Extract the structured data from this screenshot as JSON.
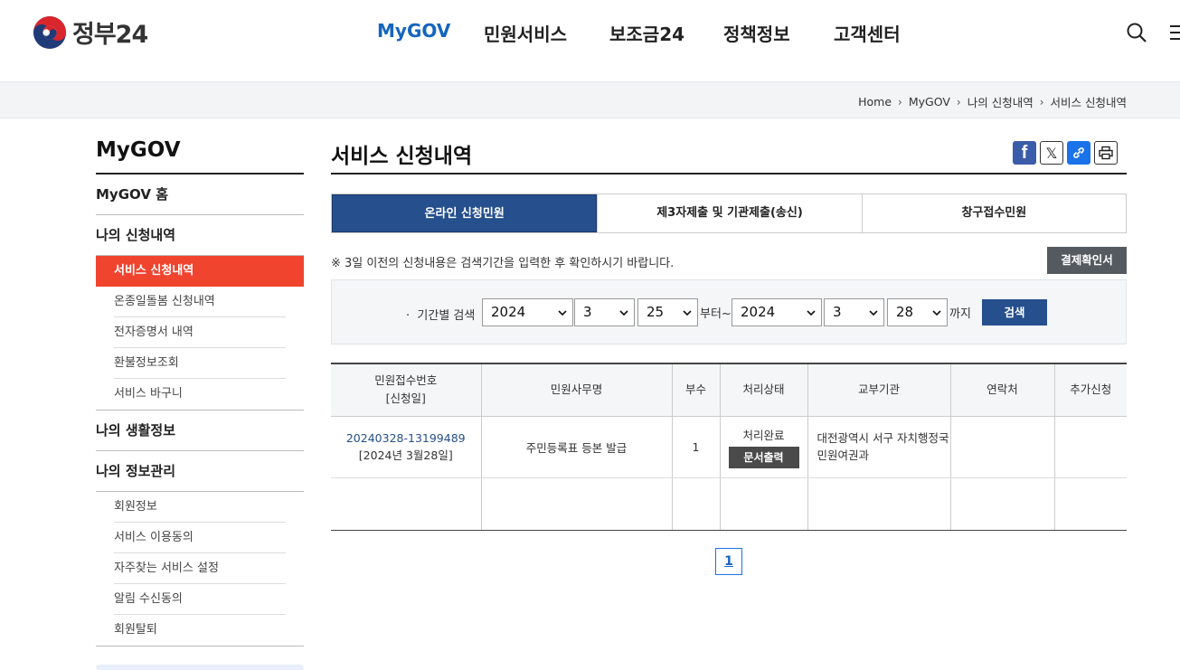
{
  "header": {
    "logo_text": "정부24",
    "nav": [
      {
        "label": "MyGOV",
        "active": true
      },
      {
        "label": "민원서비스",
        "active": false
      },
      {
        "label": "보조금24",
        "active": false
      },
      {
        "label": "정책정보",
        "active": false
      },
      {
        "label": "고객센터",
        "active": false
      }
    ],
    "icons": [
      "search-icon",
      "menu-icon"
    ]
  },
  "breadcrumb": [
    "Home",
    "MyGOV",
    "나의 신청내역",
    "서비스 신청내역"
  ],
  "sidebar": {
    "title": "MyGOV",
    "sections": [
      {
        "label": "MyGOV 홈",
        "items": []
      },
      {
        "label": "나의 신청내역",
        "items": [
          "서비스 신청내역",
          "온종일돌봄 신청내역",
          "전자증명서 내역",
          "환불정보조회",
          "서비스 바구니"
        ],
        "active_item": "서비스 신청내역"
      },
      {
        "label": "나의 생활정보",
        "items": []
      },
      {
        "label": "나의 정보관리",
        "items": [
          "회원정보",
          "서비스 이용동의",
          "자주찾는 서비스 설정",
          "알림 수신동의",
          "회원탈퇴"
        ]
      }
    ]
  },
  "main": {
    "title": "서비스 신청내역",
    "share_icons": [
      "facebook-icon",
      "x-icon",
      "link-icon",
      "print-icon"
    ],
    "tabs": [
      {
        "label": "온라인 신청민원",
        "active": true
      },
      {
        "label": "제3자제출 및 기관제출(송신)",
        "active": false
      },
      {
        "label": "창구접수민원",
        "active": false
      }
    ],
    "notice": "※ 3일 이전의 신청내용은 검색기간을 입력한 후 확인하시기 바랍니다.",
    "receipt_button": "결제확인서",
    "search": {
      "label": "기간별 검색",
      "from_year": "2024",
      "from_month": "3",
      "from_day": "25",
      "from_suffix": "부터~",
      "to_year": "2024",
      "to_month": "3",
      "to_day": "28",
      "to_suffix": "까지",
      "submit": "검색"
    },
    "table": {
      "headers": [
        "민원접수번호",
        "[신청일]",
        "민원사무명",
        "부수",
        "처리상태",
        "교부기관",
        "연락처",
        "추가신청"
      ],
      "rows": [
        {
          "receipt_no": "20240328-13199489",
          "date": "[2024년 3월28일]",
          "service": "주민등록표 등본 발급",
          "copies": "1",
          "status": "처리완료",
          "status_button": "문서출력",
          "agency": "대전광역시 서구 자치행정국 민원여권과",
          "contact": "",
          "extra": ""
        }
      ]
    },
    "pagination": {
      "current": "1"
    }
  },
  "colors": {
    "accent_blue": "#254f8d",
    "nav_active": "#1465c0",
    "sidebar_active": "#f0442f"
  }
}
